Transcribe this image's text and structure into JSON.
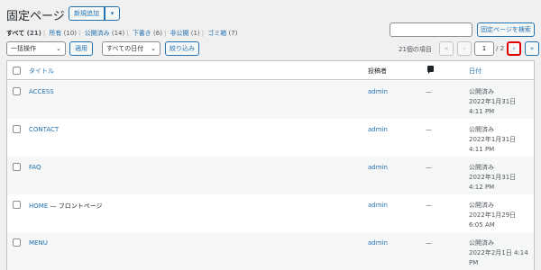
{
  "page": {
    "title": "固定ページ",
    "add_new_label": "新規追加",
    "add_new_dropdown": "▾"
  },
  "status_links": [
    {
      "label": "すべて",
      "count": "(21)",
      "current": true
    },
    {
      "label": "所有",
      "count": "(10)"
    },
    {
      "label": "公開済み",
      "count": "(14)"
    },
    {
      "label": "下書き",
      "count": "(6)"
    },
    {
      "label": "非公開",
      "count": "(1)"
    },
    {
      "label": "ゴミ箱",
      "count": "(7)"
    }
  ],
  "search": {
    "value": "",
    "button_label": "固定ページを検索"
  },
  "filters": {
    "bulk_action": "一括操作",
    "apply_label": "適用",
    "date_filter": "すべての日付",
    "filter_label": "絞り込み"
  },
  "pagination": {
    "items_count": "21個の項目",
    "first": "«",
    "prev": "‹",
    "current_page": "1",
    "of_total": "/ 2",
    "next": "›",
    "last": "»"
  },
  "table": {
    "headers": {
      "title": "タイトル",
      "author": "投稿者",
      "comments_icon": "comment-bubble-icon",
      "date": "日付"
    },
    "rows": [
      {
        "title": "ACCESS",
        "suffix": "",
        "author": "admin",
        "comments": "—",
        "status": "公開済み",
        "date": "2022年1月31日 4:11 PM"
      },
      {
        "title": "CONTACT",
        "suffix": "",
        "author": "admin",
        "comments": "—",
        "status": "公開済み",
        "date": "2022年1月31日 4:11 PM"
      },
      {
        "title": "FAQ",
        "suffix": "",
        "author": "admin",
        "comments": "—",
        "status": "公開済み",
        "date": "2022年1月31日 4:12 PM"
      },
      {
        "title": "HOME",
        "suffix": " — フロントページ",
        "author": "admin",
        "comments": "—",
        "status": "公開済み",
        "date": "2022年1月29日 6:05 AM"
      },
      {
        "title": "MENU",
        "suffix": "",
        "author": "admin",
        "comments": "—",
        "status": "公開済み",
        "date": "2022年2月1日 4:14 PM"
      }
    ]
  },
  "colors": {
    "link": "#2271b1",
    "highlight": "#dd0000"
  }
}
